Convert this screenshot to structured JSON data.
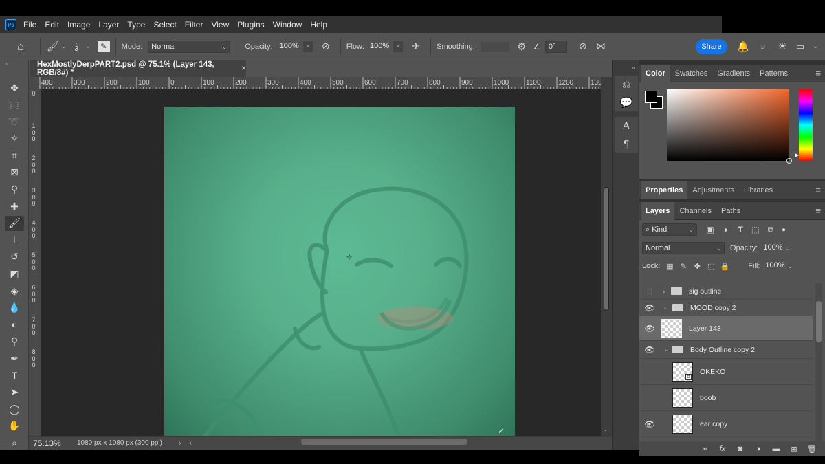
{
  "menubar": {
    "app_icon": "Ps",
    "items": [
      "File",
      "Edit",
      "Image",
      "Layer",
      "Type",
      "Select",
      "Filter",
      "View",
      "Plugins",
      "Window",
      "Help"
    ]
  },
  "options": {
    "brush_size": "3",
    "mode_label": "Mode:",
    "mode_value": "Normal",
    "opacity_label": "Opacity:",
    "opacity_value": "100%",
    "flow_label": "Flow:",
    "flow_value": "100%",
    "smoothing_label": "Smoothing:",
    "angle_value": "0°",
    "share_label": "Share"
  },
  "document": {
    "tab_title": "HexMostlyDerpPART2.psd @ 75.1% (Layer 143, RGB/8#) *",
    "close_glyph": "×",
    "zoom": "75.13%",
    "info": "1080 px x 1080 px (300 ppi)"
  },
  "ruler": {
    "h_labels": [
      "400",
      "300",
      "200",
      "100",
      "0",
      "100",
      "200",
      "300",
      "400",
      "500",
      "600",
      "700",
      "800",
      "900",
      "1000",
      "1100",
      "1200",
      "130"
    ],
    "v_labels": [
      "0",
      "1\n0\n0",
      "2\n0\n0",
      "3\n0\n0",
      "4\n0\n0",
      "5\n0\n0",
      "6\n0\n0",
      "7\n0\n0",
      "8\n0\n0"
    ]
  },
  "color_panel": {
    "tabs": [
      "Color",
      "Swatches",
      "Gradients",
      "Patterns"
    ],
    "fg_color": "#000000",
    "bg_color": "#000000"
  },
  "properties_panel": {
    "tabs": [
      "Properties",
      "Adjustments",
      "Libraries"
    ]
  },
  "layers_panel": {
    "tabs": [
      "Layers",
      "Channels",
      "Paths"
    ],
    "filter_label": "Kind",
    "blend_mode": "Normal",
    "opacity_label": "Opacity:",
    "opacity_value": "100%",
    "lock_label": "Lock:",
    "fill_label": "Fill:",
    "fill_value": "100%",
    "layers": [
      {
        "name": "sig outline",
        "type": "group",
        "visible": false,
        "expanded": false
      },
      {
        "name": "MOOD copy 2",
        "type": "group",
        "visible": true,
        "expanded": false
      },
      {
        "name": "Layer 143",
        "type": "layer",
        "visible": true,
        "selected": true
      },
      {
        "name": "Body Outline copy 2",
        "type": "group",
        "visible": true,
        "expanded": true
      },
      {
        "name": "OKEKO",
        "type": "smart",
        "visible": false
      },
      {
        "name": "boob",
        "type": "layer",
        "visible": false
      },
      {
        "name": "ear copy",
        "type": "layer",
        "visible": true
      }
    ]
  }
}
